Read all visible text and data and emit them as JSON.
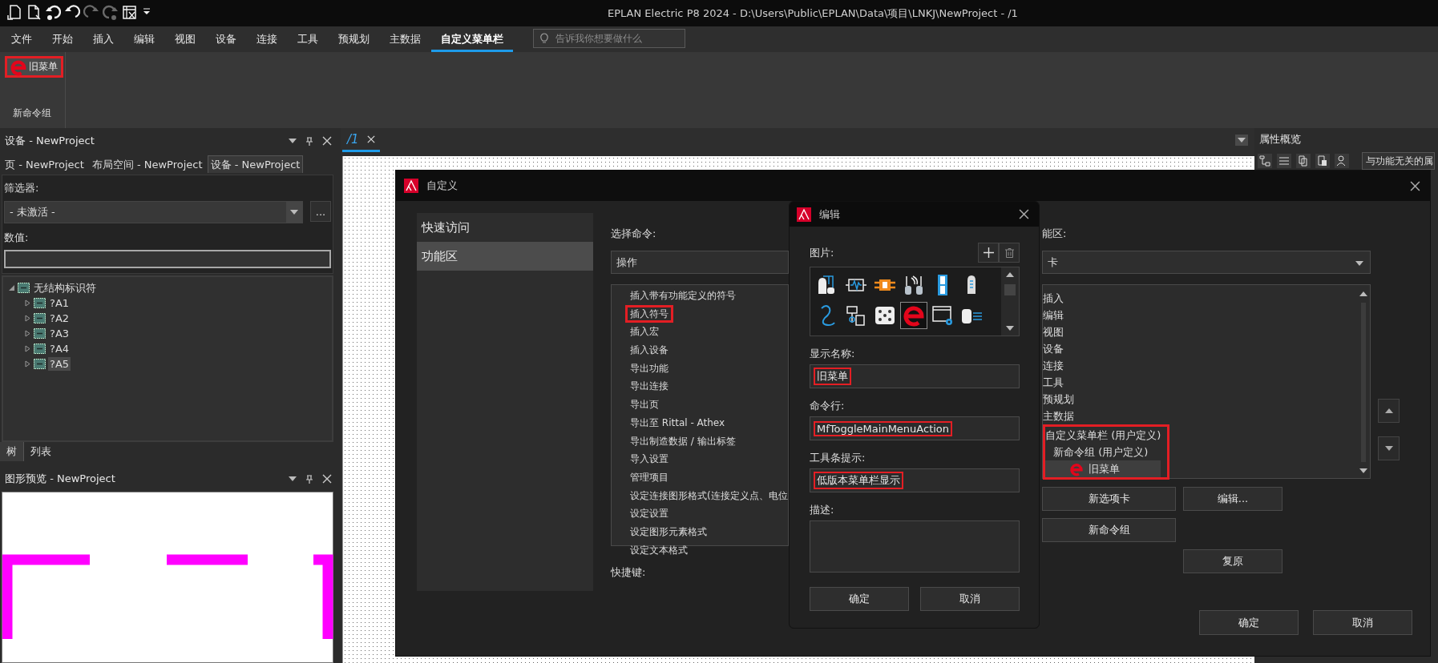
{
  "title_bar": {
    "title": "EPLAN Electric P8 2024 - D:\\Users\\Public\\EPLAN\\Data\\项目\\LNKJ\\NewProject - /1",
    "quick_access": [
      {
        "kind": "new-page",
        "disabled": false
      },
      {
        "kind": "new-doc",
        "disabled": false
      },
      {
        "kind": "undo-dot",
        "disabled": false
      },
      {
        "kind": "undo",
        "disabled": false
      },
      {
        "kind": "redo",
        "disabled": true
      },
      {
        "kind": "redo-dot",
        "disabled": true
      },
      {
        "kind": "table",
        "disabled": false
      },
      {
        "kind": "caret",
        "disabled": false
      }
    ]
  },
  "menu_tabs": [
    {
      "label": "文件",
      "selected": false
    },
    {
      "label": "开始",
      "selected": false
    },
    {
      "label": "插入",
      "selected": false
    },
    {
      "label": "编辑",
      "selected": false
    },
    {
      "label": "视图",
      "selected": false
    },
    {
      "label": "设备",
      "selected": false
    },
    {
      "label": "连接",
      "selected": false
    },
    {
      "label": "工具",
      "selected": false
    },
    {
      "label": "预规划",
      "selected": false
    },
    {
      "label": "主数据",
      "selected": false
    },
    {
      "label": "自定义菜单栏",
      "selected": true
    }
  ],
  "search": {
    "placeholder": "告诉我你想要做什么"
  },
  "ribbon": {
    "buttons": [
      {
        "label": "旧菜单",
        "marked": true
      }
    ],
    "group_label": "新命令组"
  },
  "device_panel": {
    "title": "设备 - NewProject",
    "tabs": [
      {
        "label": "页 - NewProject",
        "selected": false
      },
      {
        "label": "布局空间 - NewProject",
        "selected": false
      },
      {
        "label": "设备 - NewProject",
        "selected": true
      }
    ],
    "filter_label": "筛选器:",
    "filter_value": "- 未激活 -",
    "more_button": "...",
    "value_label": "数值:",
    "tree": [
      {
        "label": "无结构标识符",
        "expanded": true,
        "selected": false,
        "children": [
          {
            "label": "?A1",
            "expanded": false,
            "selected": false
          },
          {
            "label": "?A2",
            "expanded": false,
            "selected": false
          },
          {
            "label": "?A3",
            "expanded": false,
            "selected": false
          },
          {
            "label": "?A4",
            "expanded": false,
            "selected": false
          },
          {
            "label": "?A5",
            "expanded": false,
            "selected": true
          }
        ]
      }
    ],
    "bottom_tabs": [
      {
        "label": "树",
        "selected": true
      },
      {
        "label": "列表",
        "selected": false
      }
    ]
  },
  "preview_panel": {
    "title": "图形预览 - NewProject"
  },
  "document_tabs": [
    {
      "label": "/1",
      "selected": true
    }
  ],
  "properties_panel": {
    "title": "属性概览",
    "filter": "与功能无关的属"
  },
  "customize_dialog": {
    "title": "自定义",
    "nav": [
      {
        "label": "快速访问",
        "selected": false
      },
      {
        "label": "功能区",
        "selected": true
      }
    ],
    "command_label": "选择命令:",
    "command_category": "操作",
    "commands": [
      {
        "label": "插入带有功能定义的符号",
        "marked": false
      },
      {
        "label": "插入符号",
        "marked": true
      },
      {
        "label": "插入宏",
        "marked": false
      },
      {
        "label": "插入设备",
        "marked": false
      },
      {
        "label": "导出功能",
        "marked": false
      },
      {
        "label": "导出连接",
        "marked": false
      },
      {
        "label": "导出页",
        "marked": false
      },
      {
        "label": "导出至 Rittal - Athex",
        "marked": false
      },
      {
        "label": "导出制造数据 / 输出标签",
        "marked": false
      },
      {
        "label": "导入设置",
        "marked": false
      },
      {
        "label": "管理项目",
        "marked": false
      },
      {
        "label": "设定连接图形格式(连接定义点、电位",
        "marked": false
      },
      {
        "label": "设定设置",
        "marked": false
      },
      {
        "label": "设定图形元素格式",
        "marked": false
      },
      {
        "label": "设定文本格式",
        "marked": false
      }
    ],
    "shortcut_label": "快捷键:",
    "ribbon_label": "能区:",
    "ribbon_dropdown": "卡",
    "ribbon_tree": [
      {
        "label": "插入",
        "kind": "tab",
        "selected": false,
        "marked": false
      },
      {
        "label": "编辑",
        "kind": "tab",
        "selected": false,
        "marked": false
      },
      {
        "label": "视图",
        "kind": "tab",
        "selected": false,
        "marked": false
      },
      {
        "label": "设备",
        "kind": "tab",
        "selected": false,
        "marked": false
      },
      {
        "label": "连接",
        "kind": "tab",
        "selected": false,
        "marked": false
      },
      {
        "label": "工具",
        "kind": "tab",
        "selected": false,
        "marked": false
      },
      {
        "label": "预规划",
        "kind": "tab",
        "selected": false,
        "marked": false
      },
      {
        "label": "主数据",
        "kind": "tab",
        "selected": false,
        "marked": false
      },
      {
        "label": "自定义菜单栏 (用户定义)",
        "kind": "tab",
        "selected": false,
        "marked": true,
        "children": [
          {
            "label": "新命令组 (用户定义)",
            "kind": "group",
            "selected": false,
            "marked": false,
            "children": [
              {
                "label": "旧菜单",
                "kind": "command",
                "selected": true,
                "marked": false
              }
            ]
          }
        ]
      }
    ],
    "action_buttons": [
      "新选项卡",
      "编辑...",
      "新命令组",
      "复原"
    ],
    "footer_buttons": [
      "确定",
      "取消"
    ]
  },
  "edit_dialog": {
    "title": "编辑",
    "picture_label": "图片:",
    "pictures": [
      {
        "kind": "plc",
        "selected": false
      },
      {
        "kind": "pulse",
        "selected": false
      },
      {
        "kind": "coil",
        "selected": false
      },
      {
        "kind": "sensor",
        "selected": false
      },
      {
        "kind": "terminal",
        "selected": false
      },
      {
        "kind": "tube",
        "selected": false
      },
      {
        "kind": "wire",
        "selected": false
      },
      {
        "kind": "module",
        "selected": false
      },
      {
        "kind": "dice",
        "selected": false
      },
      {
        "kind": "eplan",
        "selected": true
      },
      {
        "kind": "window-gear",
        "selected": false
      },
      {
        "kind": "cylinder",
        "selected": false
      }
    ],
    "fields": [
      {
        "label": "显示名称:",
        "value": "旧菜单",
        "kind": "line",
        "marked": true
      },
      {
        "label": "命令行:",
        "value": "MfToggleMainMenuAction",
        "kind": "line",
        "marked": true
      },
      {
        "label": "工具条提示:",
        "value": "低版本菜单栏显示",
        "kind": "line",
        "marked": true
      },
      {
        "label": "描述:",
        "kind": "multiline",
        "marked": false
      }
    ],
    "buttons": [
      "确定",
      "取消"
    ]
  }
}
